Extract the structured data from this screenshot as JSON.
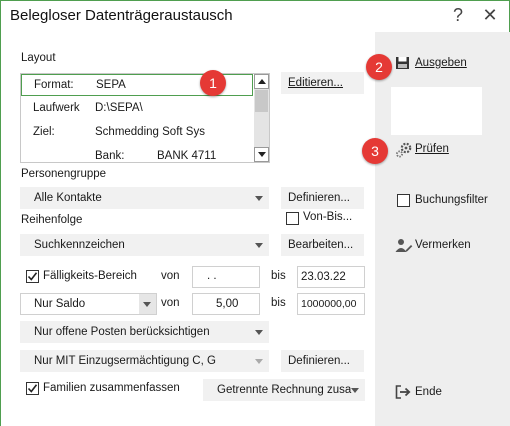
{
  "window": {
    "title": "Belegloser Datenträgeraustausch",
    "help_glyph": "?",
    "close_glyph": "✕"
  },
  "layout": {
    "section_label": "Layout",
    "rows": [
      {
        "key": "Format:",
        "value": "SEPA"
      },
      {
        "key": "Laufwerk",
        "value": "D:\\SEPA\\"
      },
      {
        "key": "Ziel:",
        "value": "Schmedding Soft Sys"
      },
      {
        "key": "Bank:",
        "value": "BANK 4711"
      }
    ],
    "edit_button": "Editieren..."
  },
  "personengruppe": {
    "label": "Personengruppe",
    "selected": "Alle Kontakte",
    "define_button": "Definieren...",
    "von_bis_label": "Von-Bis..."
  },
  "reihenfolge": {
    "label": "Reihenfolge",
    "selected": "Suchkennzeichen",
    "edit_button": "Bearbeiten..."
  },
  "faelligkeit": {
    "label": "Fälligkeits-Bereich",
    "checked": true,
    "von_label": "von",
    "von_value": ". .",
    "bis_label": "bis",
    "bis_value": "23.03.22"
  },
  "saldo": {
    "selected": "Nur Saldo",
    "von_label": "von",
    "von_value": "5,00",
    "bis_label": "bis",
    "bis_value": "1000000,00"
  },
  "offene_posten": {
    "selected": "Nur offene Posten berücksichtigen"
  },
  "einzug": {
    "selected": "Nur MIT Einzugsermächtigung C, G",
    "define_button": "Definieren..."
  },
  "familien": {
    "label": "Familien zusammenfassen",
    "checked": true,
    "rechnung_selected": "Getrennte Rechnung zusa"
  },
  "side": {
    "ausgeben": "Ausgeben",
    "pruefen": "Prüfen",
    "buchungsfilter": "Buchungsfilter",
    "vermerken": "Vermerken",
    "ende": "Ende"
  },
  "badges": [
    "1",
    "2",
    "3"
  ],
  "colors": {
    "accent_green": "#4f9e4f",
    "badge_red": "#e53935",
    "sidebar_bg": "#eeeeee"
  }
}
